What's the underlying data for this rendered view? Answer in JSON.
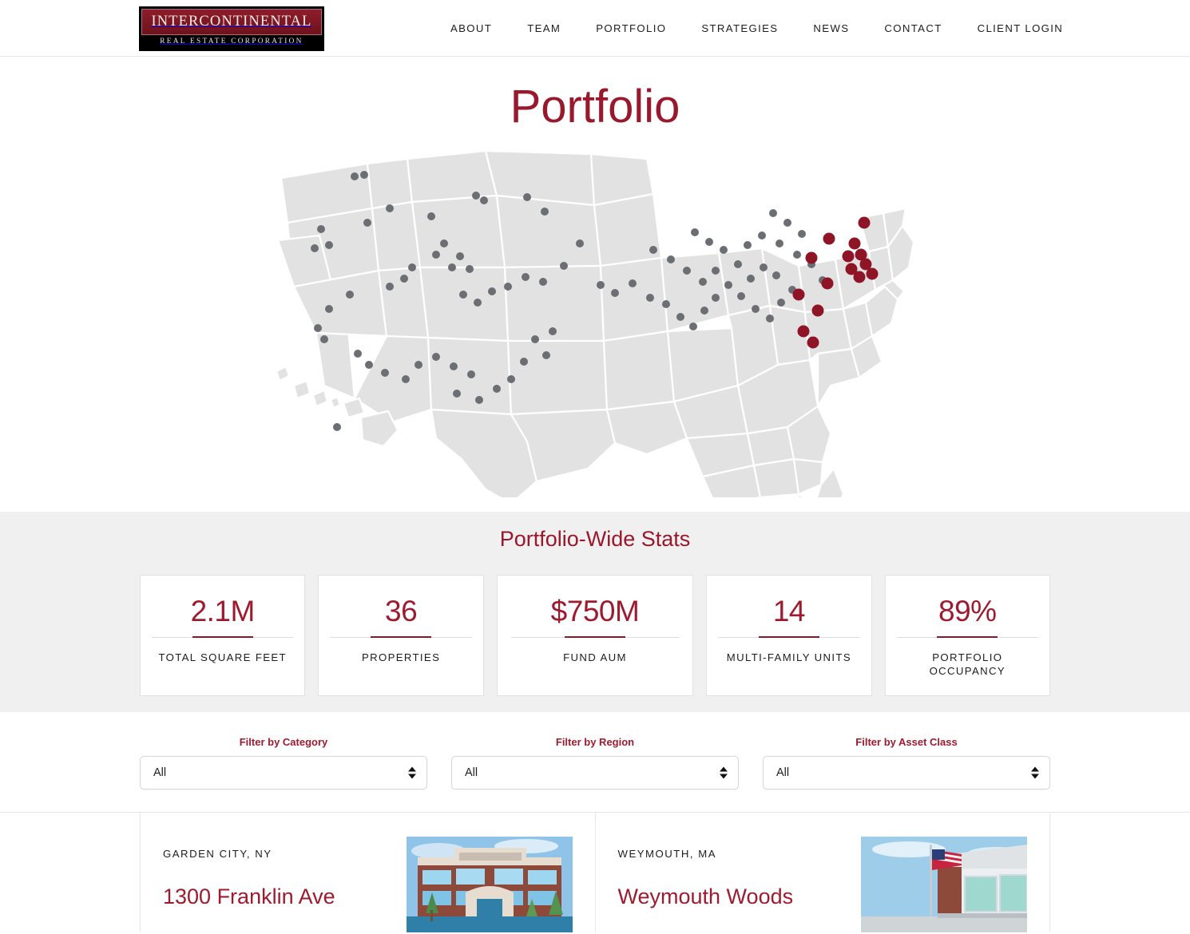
{
  "header": {
    "logo": {
      "top_text": "INTERCONTINENTAL",
      "bottom_text": "REAL ESTATE CORPORATION"
    },
    "nav": [
      {
        "label": "ABOUT"
      },
      {
        "label": "TEAM"
      },
      {
        "label": "PORTFOLIO"
      },
      {
        "label": "STRATEGIES"
      },
      {
        "label": "NEWS"
      },
      {
        "label": "CONTACT"
      },
      {
        "label": "CLIENT LOGIN"
      }
    ]
  },
  "hero": {
    "title": "Portfolio"
  },
  "map": {
    "land_color": "#e2e2e2",
    "border_color": "#ffffff",
    "active_marker_color": "#8e1426",
    "inactive_marker_color": "#6b6e72"
  },
  "stats": {
    "heading": "Portfolio-Wide Stats",
    "accent_color": "#9e1b2f",
    "cards": [
      {
        "value": "2.1M",
        "label": "TOTAL SQUARE FEET"
      },
      {
        "value": "36",
        "label": "PROPERTIES"
      },
      {
        "value": "$750M",
        "label": "FUND AUM"
      },
      {
        "value": "14",
        "label": "MULTI-FAMILY UNITS"
      },
      {
        "value": "89%",
        "label": "PORTFOLIO OCCUPANCY"
      }
    ]
  },
  "filters": [
    {
      "label": "Filter by Category",
      "value": "All",
      "options": [
        "All"
      ]
    },
    {
      "label": "Filter by Region",
      "value": "All",
      "options": [
        "All"
      ]
    },
    {
      "label": "Filter by Asset Class",
      "value": "All",
      "options": [
        "All"
      ]
    }
  ],
  "properties": [
    {
      "location": "GARDEN CITY, NY",
      "title": "1300 Franklin Ave"
    },
    {
      "location": "WEYMOUTH, MA",
      "title": "Weymouth Woods"
    }
  ]
}
